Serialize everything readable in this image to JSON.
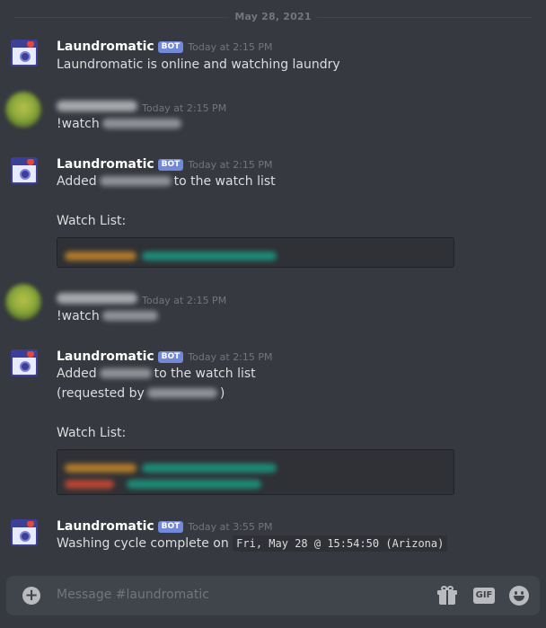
{
  "date_divider": "May 28, 2021",
  "bot": {
    "name": "Laundromatic",
    "tag": "BOT"
  },
  "messages": [
    {
      "timestamp": "Today at 2:15 PM",
      "text": "Laundromatic is online and watching laundry"
    },
    {
      "timestamp": "Today at 2:15 PM",
      "text": "!watch"
    },
    {
      "timestamp": "Today at 2:15 PM",
      "text_prefix": "Added",
      "text_suffix": "to the watch list",
      "watch_label": "Watch List:"
    },
    {
      "timestamp": "Today at 2:15 PM",
      "text": "!watch"
    },
    {
      "timestamp": "Today at 2:15 PM",
      "text_prefix": "Added",
      "text_suffix": "to the watch list",
      "requested_prefix": "(requested by",
      "requested_suffix": ")",
      "watch_label": "Watch List:"
    },
    {
      "timestamp": "Today at 3:55 PM",
      "text": "Washing cycle complete on",
      "code": "Fri, May 28 @ 15:54:50 (Arizona)"
    }
  ],
  "composer": {
    "placeholder": "Message #laundromatic",
    "gif_label": "GIF"
  },
  "icons": [
    "laundromatic-avatar-icon",
    "user-avatar-icon",
    "add-attachment-icon",
    "gift-icon",
    "gif-icon",
    "emoji-icon"
  ],
  "colors": {
    "background": "#36393f",
    "bot_tag": "#7289da",
    "embed": "#2f3136",
    "input": "#40444b"
  }
}
